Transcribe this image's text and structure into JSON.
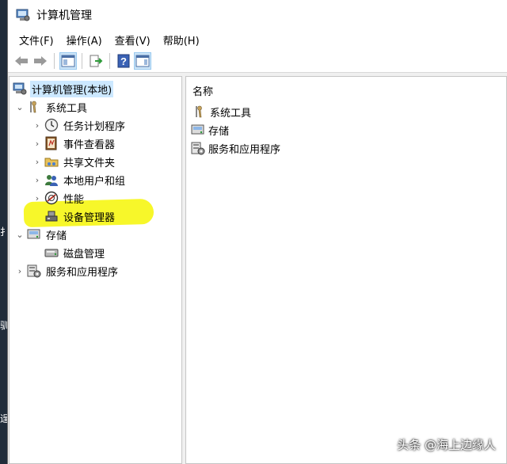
{
  "window": {
    "title": "计算机管理"
  },
  "menu": {
    "file": "文件(F)",
    "action": "操作(A)",
    "view": "查看(V)",
    "help": "帮助(H)"
  },
  "tree": {
    "root": "计算机管理(本地)",
    "system_tools": "系统工具",
    "task_scheduler": "任务计划程序",
    "event_viewer": "事件查看器",
    "shared_folders": "共享文件夹",
    "local_users": "本地用户和组",
    "performance": "性能",
    "device_manager": "设备管理器",
    "storage": "存储",
    "disk_management": "磁盘管理",
    "services_apps": "服务和应用程序"
  },
  "list": {
    "header": "名称",
    "items": [
      "系统工具",
      "存储",
      "服务和应用程序"
    ]
  },
  "desktop": {
    "frag1": "扌",
    "frag2": "驯",
    "frag3": "逞"
  },
  "watermark": "头条 @海上边缘人",
  "colors": {
    "highlight": "#f7f72a",
    "selection": "#cce8ff"
  }
}
